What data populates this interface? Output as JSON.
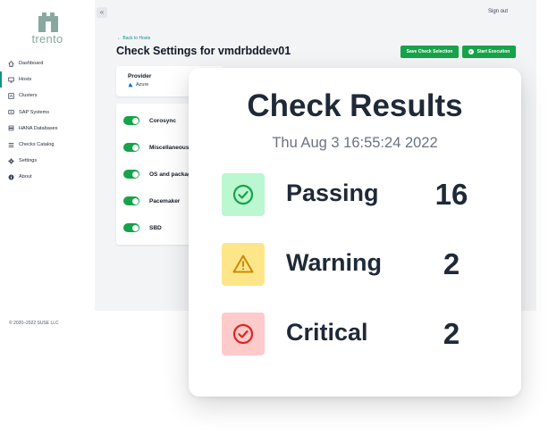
{
  "brand": {
    "name": "trento",
    "logo_color": "#86a89e"
  },
  "sidebar": {
    "items": [
      {
        "label": "Dashboard",
        "icon": "home-icon"
      },
      {
        "label": "Hosts",
        "icon": "desktop-icon"
      },
      {
        "label": "Clusters",
        "icon": "cluster-icon"
      },
      {
        "label": "SAP Systems",
        "icon": "sap-icon"
      },
      {
        "label": "HANA Databases",
        "icon": "database-icon"
      },
      {
        "label": "Checks Catalog",
        "icon": "list-icon"
      },
      {
        "label": "Settings",
        "icon": "gear-icon"
      },
      {
        "label": "About",
        "icon": "info-icon"
      }
    ],
    "active_index": 1
  },
  "header": {
    "collapse_symbol": "«",
    "signout_label": "Sign out"
  },
  "page": {
    "back_link": "← Back to Hosts",
    "title": "Check Settings for vmdrbddev01",
    "save_button": "Save Check Selection",
    "start_button": "Start Execution",
    "accent_color": "#16a34a"
  },
  "provider": {
    "label": "Provider",
    "value": "Azure"
  },
  "checks": [
    {
      "label": "Corosync",
      "enabled": true
    },
    {
      "label": "Miscellaneous",
      "enabled": true
    },
    {
      "label": "OS and packages",
      "enabled": true
    },
    {
      "label": "Pacemaker",
      "enabled": true
    },
    {
      "label": "SBD",
      "enabled": true
    }
  ],
  "footer": {
    "copyright": "© 2020–2022 SUSE LLC"
  },
  "results": {
    "title": "Check Results",
    "date": "Thu Aug 3 16:55:24 2022",
    "rows": [
      {
        "label": "Passing",
        "count": "16",
        "icon": "check-circle-icon",
        "badge_color": "#bbf7d0",
        "icon_color": "#16a34a"
      },
      {
        "label": "Warning",
        "count": "2",
        "icon": "warning-triangle-icon",
        "badge_color": "#fde68a",
        "icon_color": "#ca8a04"
      },
      {
        "label": "Critical",
        "count": "2",
        "icon": "critical-circle-icon",
        "badge_color": "#fecaca",
        "icon_color": "#dc2626"
      }
    ]
  }
}
